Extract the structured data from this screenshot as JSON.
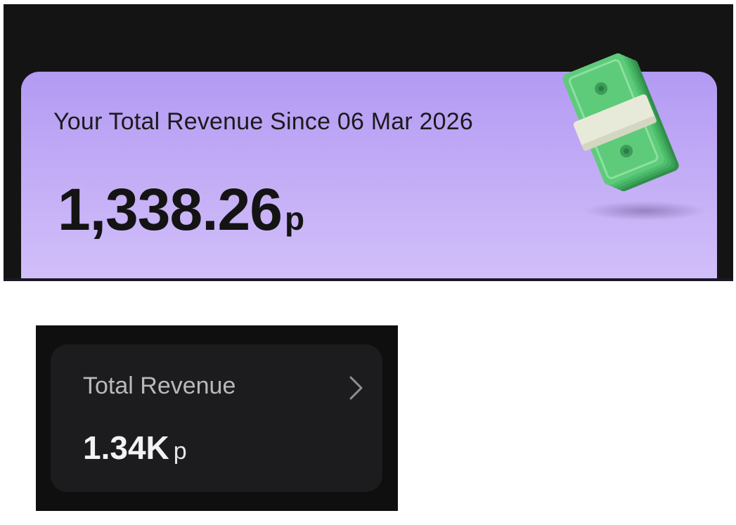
{
  "revenue_card": {
    "heading": "Your Total Revenue Since 06 Mar 2026",
    "amount": "1,338.26",
    "unit": "p",
    "illustration": "money-stack-icon"
  },
  "summary_card": {
    "title": "Total Revenue",
    "amount": "1.34K",
    "unit": "p",
    "chevron": "chevron-right-icon"
  },
  "colors": {
    "card_gradient_top": "#b39af3",
    "card_gradient_bottom": "#d4c3fa",
    "dark_background": "#141414",
    "summary_card_bg": "#1c1c1e",
    "money_green": "#5ecb7a"
  }
}
